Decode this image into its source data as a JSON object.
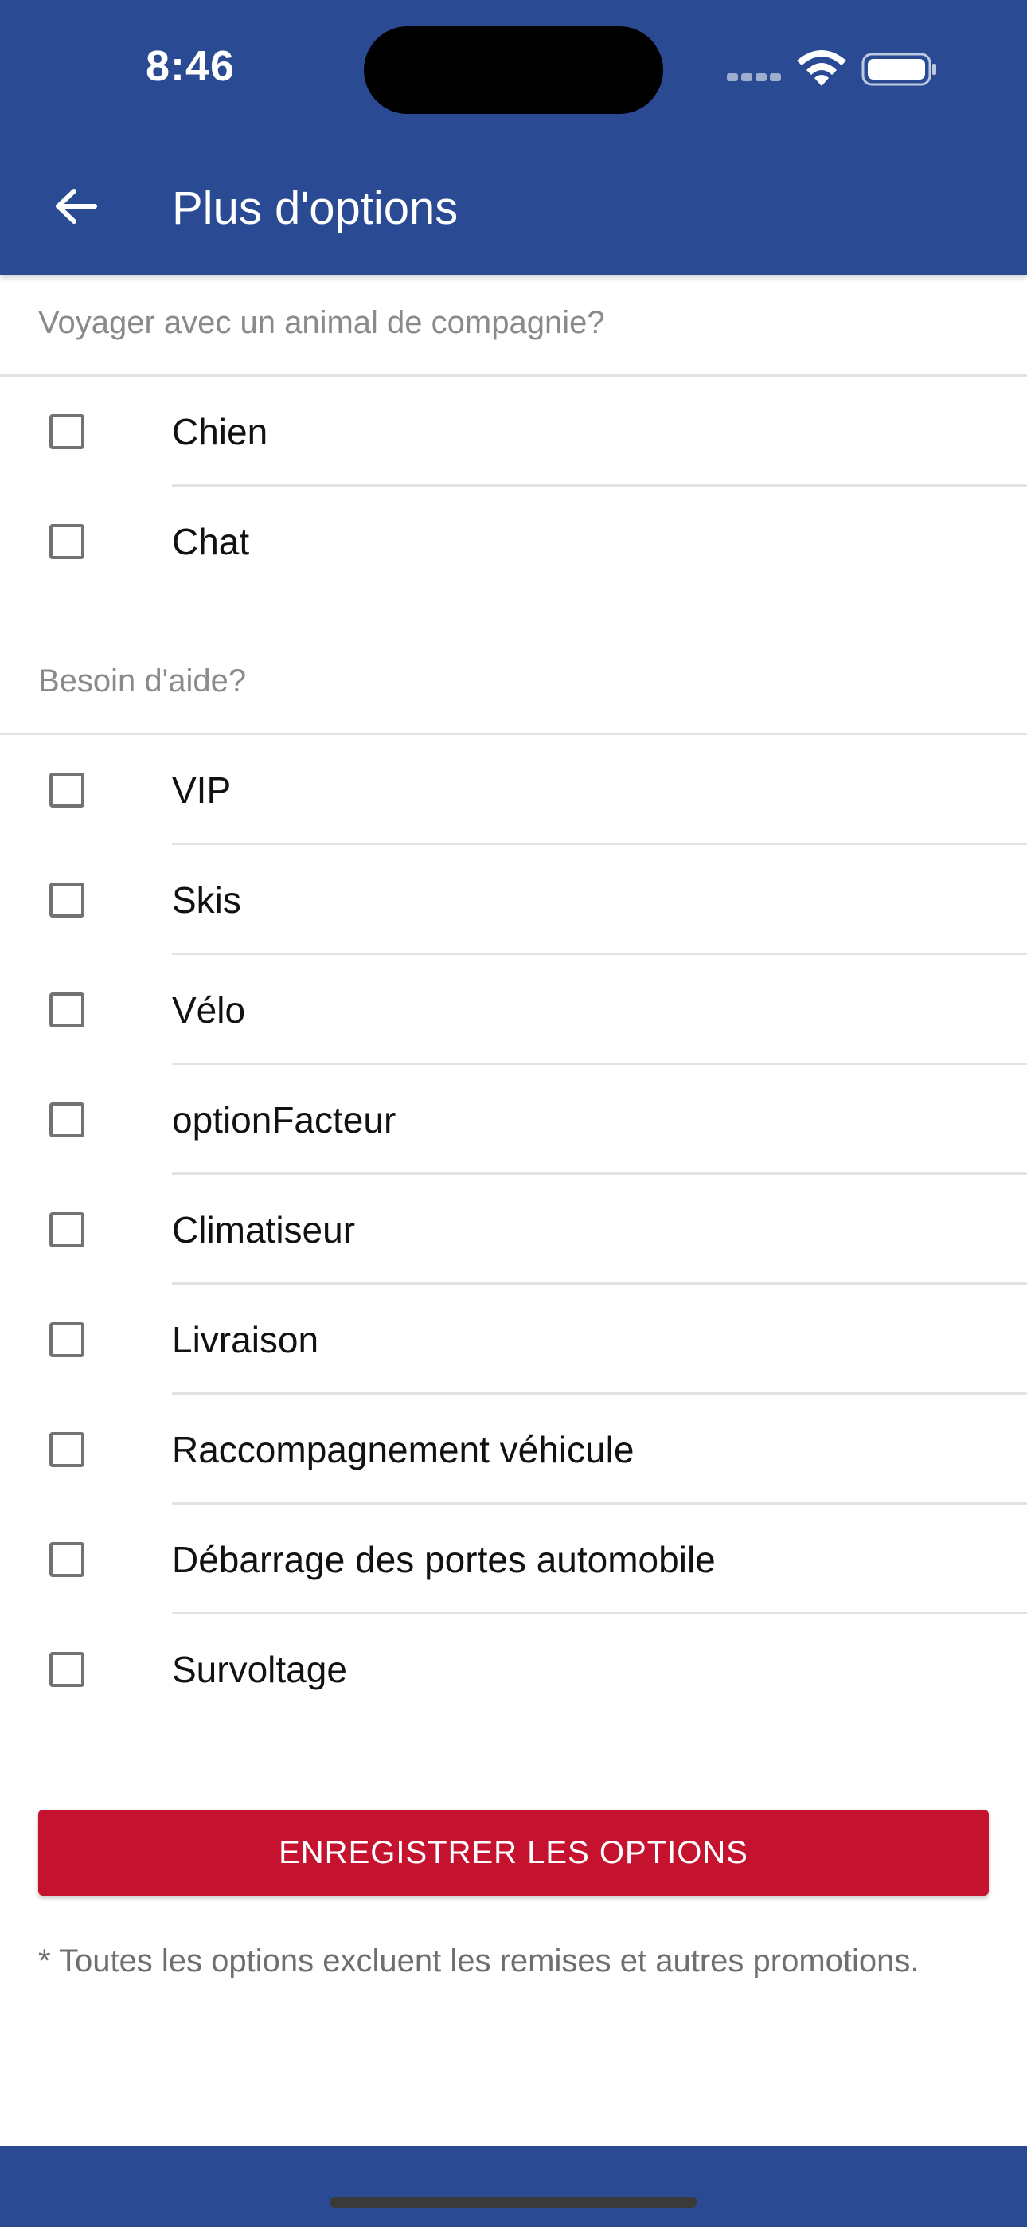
{
  "status_bar": {
    "time": "8:46",
    "icons": [
      "signal-dots-icon",
      "wifi-icon",
      "battery-icon"
    ]
  },
  "app_bar": {
    "back_icon": "arrow-left-icon",
    "title": "Plus d'options"
  },
  "sections": [
    {
      "header": "Voyager avec un animal de compagnie?",
      "options": [
        {
          "label": "Chien",
          "checked": false
        },
        {
          "label": "Chat",
          "checked": false
        }
      ]
    },
    {
      "header": "Besoin d'aide?",
      "options": [
        {
          "label": "VIP",
          "checked": false
        },
        {
          "label": "Skis",
          "checked": false
        },
        {
          "label": "Vélo",
          "checked": false
        },
        {
          "label": "optionFacteur",
          "checked": false
        },
        {
          "label": "Climatiseur",
          "checked": false
        },
        {
          "label": "Livraison",
          "checked": false
        },
        {
          "label": "Raccompagnement véhicule",
          "checked": false
        },
        {
          "label": "Débarrage des portes automobile",
          "checked": false
        },
        {
          "label": "Survoltage",
          "checked": false
        }
      ]
    }
  ],
  "save_button": {
    "label": "ENREGISTRER LES OPTIONS"
  },
  "footnote": "* Toutes les options excluent les remises et autres promotions.",
  "colors": {
    "primary": "#2a4b93",
    "accent": "#c4122f",
    "checkbox_border": "#727272",
    "section_header_text": "#8a8a8a"
  }
}
